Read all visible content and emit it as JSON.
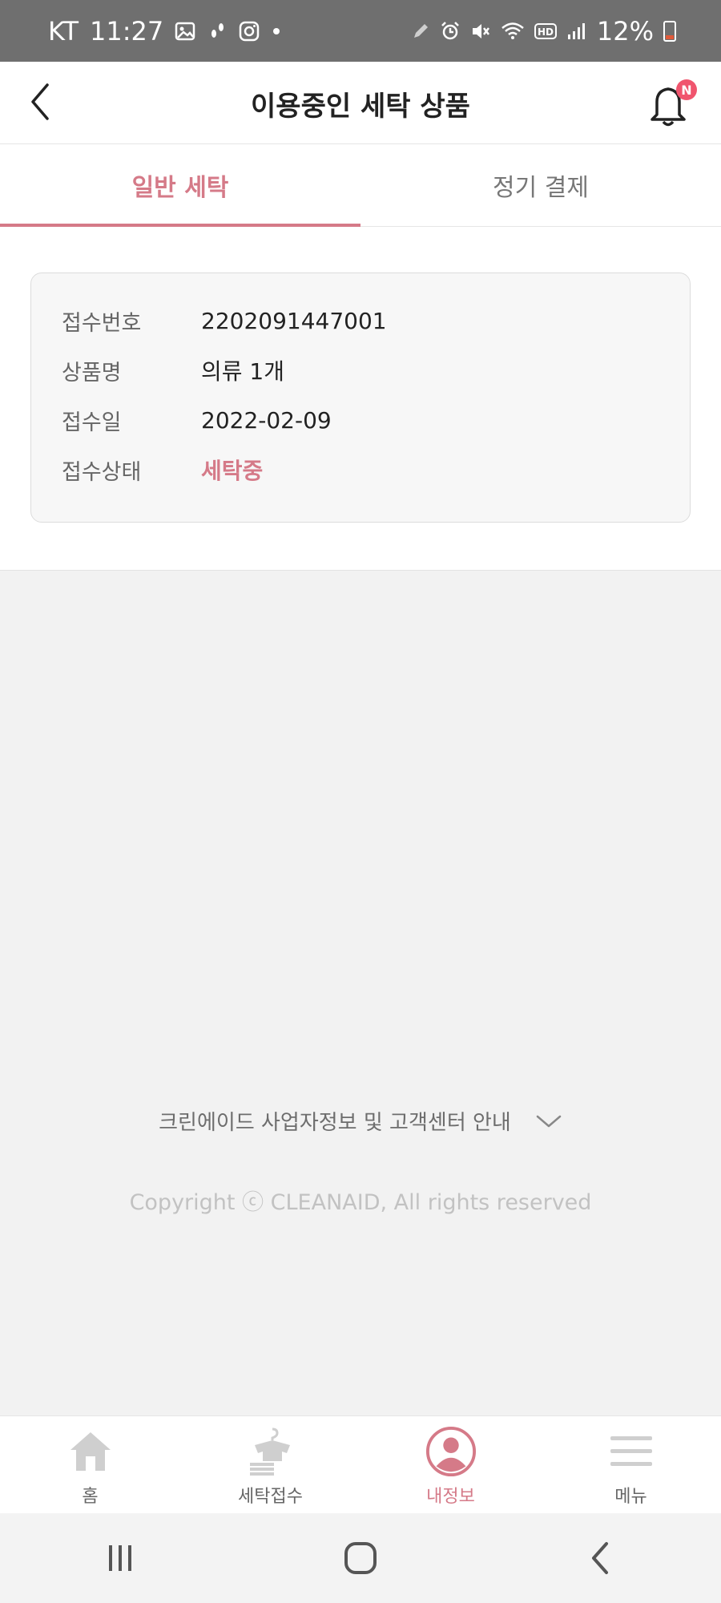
{
  "status_bar": {
    "carrier": "KT",
    "time": "11:27",
    "battery": "12%",
    "icons_left": [
      "image-icon",
      "footprint-icon",
      "instagram-icon",
      "dot-icon"
    ],
    "icons_right": [
      "pen-icon",
      "alarm-icon",
      "mute-icon",
      "wifi-icon",
      "hd-icon",
      "signal-icon",
      "battery-icon"
    ]
  },
  "header": {
    "title": "이용중인 세탁 상품",
    "badge": "N"
  },
  "tabs": [
    {
      "label": "일반 세탁",
      "active": true
    },
    {
      "label": "정기 결제",
      "active": false
    }
  ],
  "order": {
    "rows": [
      {
        "label": "접수번호",
        "value": "2202091447001"
      },
      {
        "label": "상품명",
        "value": "의류 1개"
      },
      {
        "label": "접수일",
        "value": "2022-02-09"
      },
      {
        "label": "접수상태",
        "value": "세탁중"
      }
    ]
  },
  "footer": {
    "info_text": "크린에이드 사업자정보 및 고객센터 안내",
    "copyright": "Copyright ⓒ CLEANAID, All rights reserved"
  },
  "bottom_nav": [
    {
      "label": "홈",
      "icon": "home-icon",
      "active": false
    },
    {
      "label": "세탁접수",
      "icon": "laundry-icon",
      "active": false
    },
    {
      "label": "내정보",
      "icon": "profile-icon",
      "active": true
    },
    {
      "label": "메뉴",
      "icon": "menu-icon",
      "active": false
    }
  ],
  "colors": {
    "accent": "#d57a88",
    "badge": "#f0556e",
    "status_bar": "#6f6f6f",
    "background": "#f2f2f2"
  }
}
